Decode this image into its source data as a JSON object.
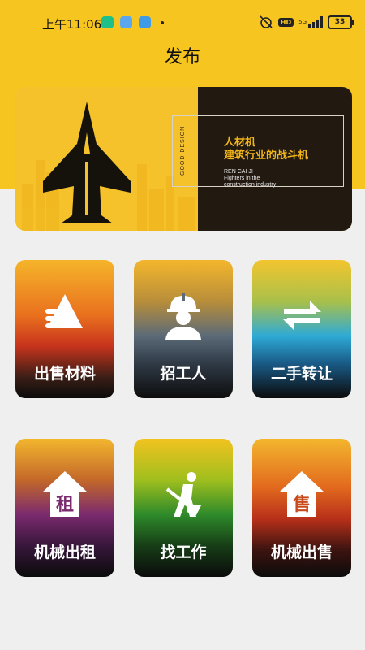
{
  "status_bar": {
    "time": "上午11:06",
    "hd": "HD",
    "network": "5G",
    "battery": "33"
  },
  "header": {
    "title": "发布"
  },
  "banner": {
    "side_label": "GOOD DESIGN",
    "title_line1": "人材机",
    "title_line2": "建筑行业的战斗机",
    "sub_line1": "REN CAI JI",
    "sub_line2": "Fighters in the",
    "sub_line3": "construction industry"
  },
  "cards": [
    {
      "label": "出售材料",
      "icon": "materials-sale-icon"
    },
    {
      "label": "招工人",
      "icon": "worker-helmet-icon"
    },
    {
      "label": "二手转让",
      "icon": "transfer-arrows-icon"
    },
    {
      "label": "机械出租",
      "icon": "house-rent-icon",
      "badge": "租"
    },
    {
      "label": "找工作",
      "icon": "digging-worker-icon"
    },
    {
      "label": "机械出售",
      "icon": "house-sale-icon",
      "badge": "售"
    }
  ]
}
